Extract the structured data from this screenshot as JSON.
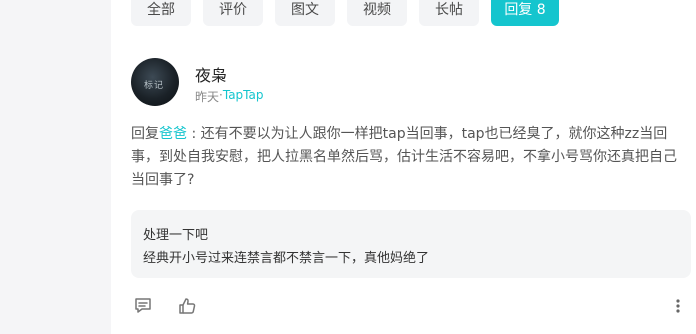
{
  "filters": {
    "tabs": [
      {
        "label": "全部"
      },
      {
        "label": "评价"
      },
      {
        "label": "图文"
      },
      {
        "label": "视频"
      },
      {
        "label": "长帖"
      },
      {
        "label": "回复 8"
      }
    ],
    "active_index": 5
  },
  "post": {
    "user": {
      "name": "夜枭",
      "avatar_text": "标记"
    },
    "meta": {
      "time": "昨天",
      "separator": " · ",
      "source": "TapTap"
    },
    "reply_prefix": "回复",
    "reply_target": "爸爸",
    "reply_colon": " : ",
    "content": "还有不要以为让人跟你一样把tap当回事，tap也已经臭了，就你这种zz当回事，到处自我安慰，把人拉黑名单然后骂，估计生活不容易吧，不拿小号骂你还真把自己当回事了?",
    "quote": {
      "title": "处理一下吧",
      "text": "经典开小号过来连禁言都不禁言一下，真他妈绝了"
    }
  },
  "icons": {
    "reply": "comment-icon",
    "like": "thumbs-up-icon",
    "more": "more-vertical-icon"
  },
  "colors": {
    "accent": "#15c5ce",
    "tab_bg": "#f3f4f6",
    "quote_bg": "#f4f5f6",
    "gutter_bg": "#f5f5f7"
  }
}
